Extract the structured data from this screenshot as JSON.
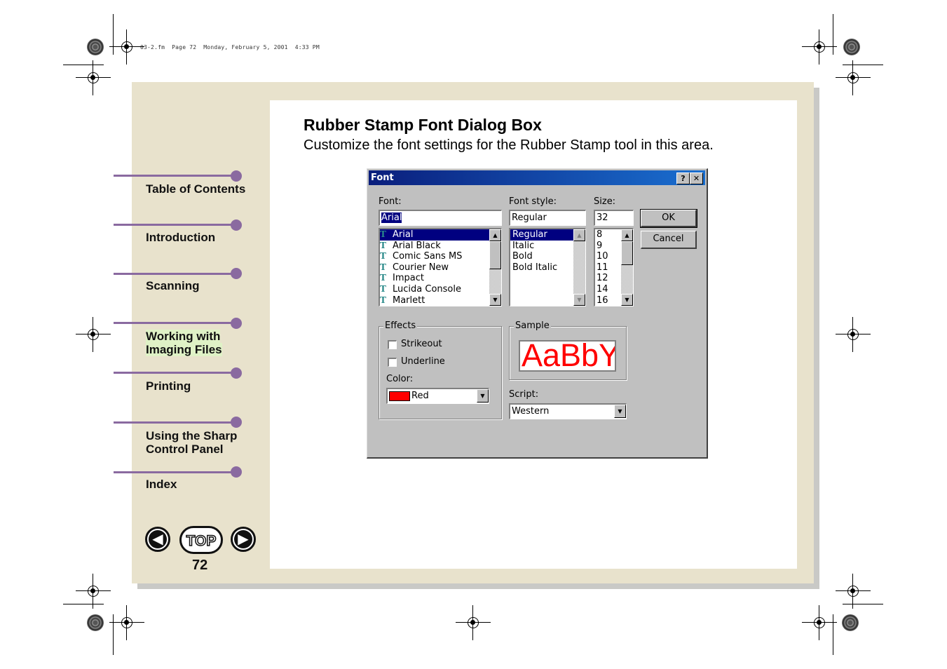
{
  "print_header": "03-2.fm  Page 72  Monday, February 5, 2001  4:33 PM",
  "sidebar": {
    "items": [
      {
        "label": "Table of Contents"
      },
      {
        "label": "Introduction"
      },
      {
        "label": "Scanning"
      },
      {
        "label": "Working with Imaging Files",
        "line1": "Working with",
        "line2": "Imaging Files"
      },
      {
        "label": "Printing"
      },
      {
        "label": "Using the Sharp Control Panel",
        "line1": "Using the Sharp",
        "line2": "Control Panel"
      },
      {
        "label": "Index"
      }
    ],
    "accent_color": "#8a6aa0"
  },
  "section": {
    "title": "Rubber Stamp Font Dialog Box",
    "description": "Customize the font settings for the Rubber Stamp tool in this area."
  },
  "dialog": {
    "title": "Font",
    "help_button": "?",
    "close_button": "✕",
    "font_label": "Font:",
    "font_value": "Arial",
    "fonts": [
      "Arial",
      "Arial Black",
      "Comic Sans MS",
      "Courier New",
      "Impact",
      "Lucida Console",
      "Marlett"
    ],
    "style_label": "Font style:",
    "style_value": "Regular",
    "styles": [
      "Regular",
      "Italic",
      "Bold",
      "Bold Italic"
    ],
    "size_label": "Size:",
    "size_value": "32",
    "sizes": [
      "8",
      "9",
      "10",
      "11",
      "12",
      "14",
      "16"
    ],
    "ok_label": "OK",
    "cancel_label": "Cancel",
    "effects_label": "Effects",
    "strikeout_label": "Strikeout",
    "underline_label": "Underline",
    "color_label": "Color:",
    "color_value": "Red",
    "color_swatch": "#ff0000",
    "sample_label": "Sample",
    "sample_text": "AaBbYy",
    "script_label": "Script:",
    "script_value": "Western"
  },
  "footer": {
    "prev_icon": "prev-arrow-icon",
    "top_label": "TOP",
    "next_icon": "next-arrow-icon",
    "page_number": "72"
  }
}
